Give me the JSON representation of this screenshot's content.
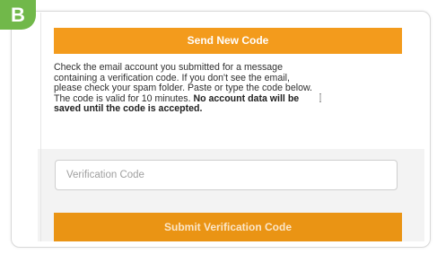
{
  "badge": {
    "label": "B"
  },
  "send_new_code": {
    "label": "Send New Code"
  },
  "message": {
    "lines": [
      "Check the email account you submitted for a message",
      "containing a verification code. If you don't see the email,",
      "please check your spam folder. Paste or type the code below.",
      "The code is valid for 10 minutes. "
    ],
    "bold_part_1": "No account data will be",
    "bold_part_2": "saved until the code is accepted."
  },
  "verification": {
    "placeholder": "Verification Code",
    "value": ""
  },
  "submit": {
    "label": "Submit Verification Code"
  },
  "colors": {
    "accent_orange": "#f39b1c",
    "badge_green": "#71b84a"
  },
  "icons": {
    "cursor": "text-cursor-icon"
  }
}
